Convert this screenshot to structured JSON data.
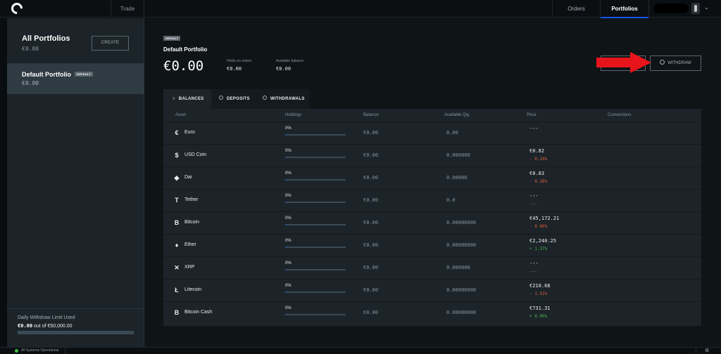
{
  "topbar": {
    "nav_trade": "Trade",
    "nav_orders": "Orders",
    "nav_portfolios": "Portfolios",
    "chevron": "⌄"
  },
  "sidebar": {
    "all_portfolios_title": "All Portfolios",
    "all_portfolios_value": "€0.00",
    "create_label": "CREATE",
    "selected_portfolio": {
      "name": "Default Portfolio",
      "badge": "DEFAULT",
      "value": "€0.00"
    },
    "withdraw_limit_label": "Daily Withdraw Limit Used",
    "withdraw_limit_used": "€0.00",
    "withdraw_limit_rest": " out of €50,000.00",
    "withdraw_limit_fraction": 0
  },
  "main": {
    "badge": "DEFAULT",
    "title": "Default Portfolio",
    "total_value": "€0.00",
    "holds_label": "Holds on orders",
    "holds_value": "€0.00",
    "available_label": "Available balance",
    "available_value": "€0.00",
    "withdraw_label": "WITHDRAW",
    "annotation_arrow_color": "#e8141b"
  },
  "tabs": [
    {
      "label": "BALANCES",
      "icon": "balances-icon",
      "active": true
    },
    {
      "label": "DEPOSITS",
      "icon": "deposit-icon",
      "active": false
    },
    {
      "label": "WITHDRAWALS",
      "icon": "withdraw-icon",
      "active": false
    }
  ],
  "table": {
    "headers": [
      "Asset",
      "Holdings",
      "Balance",
      "Available Qty.",
      "Price",
      "Conversions"
    ],
    "rows": [
      {
        "icon": "euro-icon",
        "glyph": "€",
        "asset": "Euro",
        "holdings": "0%",
        "holdings_fraction": 0,
        "balance": "€0.00",
        "qty": "0.00",
        "price": "---",
        "change": "",
        "trend": "dash"
      },
      {
        "icon": "usdc-icon",
        "glyph": "$",
        "asset": "USD Coin",
        "holdings": "0%",
        "holdings_fraction": 0,
        "balance": "€0.00",
        "qty": "0.000000",
        "price": "€0.82",
        "change": "- 0.24%",
        "trend": "neg"
      },
      {
        "icon": "dai-icon",
        "glyph": "◆",
        "asset": "Dai",
        "holdings": "0%",
        "holdings_fraction": 0,
        "balance": "€0.00",
        "qty": "0.00000",
        "price": "€0.83",
        "change": "- 0.28%",
        "trend": "neg"
      },
      {
        "icon": "tether-icon",
        "glyph": "T",
        "asset": "Tether",
        "holdings": "0%",
        "holdings_fraction": 0,
        "balance": "€0.00",
        "qty": "0.0",
        "price": "---",
        "change": "---",
        "trend": "dash"
      },
      {
        "icon": "bitcoin-icon",
        "glyph": "B",
        "asset": "Bitcoin",
        "holdings": "0%",
        "holdings_fraction": 0,
        "balance": "€0.00",
        "qty": "0.00000000",
        "price": "€45,172.21",
        "change": "- 0.80%",
        "trend": "neg"
      },
      {
        "icon": "ether-icon",
        "glyph": "♦",
        "asset": "Ether",
        "holdings": "0%",
        "holdings_fraction": 0,
        "balance": "€0.00",
        "qty": "0.00000000",
        "price": "€2,240.25",
        "change": "+ 1.37%",
        "trend": "pos"
      },
      {
        "icon": "xrp-icon",
        "glyph": "✕",
        "asset": "XRP",
        "holdings": "0%",
        "holdings_fraction": 0,
        "balance": "€0.00",
        "qty": "0.000000",
        "price": "---",
        "change": "---",
        "trend": "dash"
      },
      {
        "icon": "litecoin-icon",
        "glyph": "Ł",
        "asset": "Litecoin",
        "holdings": "0%",
        "holdings_fraction": 0,
        "balance": "€0.00",
        "qty": "0.00000000",
        "price": "€210.68",
        "change": "- 1.51%",
        "trend": "neg"
      },
      {
        "icon": "bitcoin-cash-icon",
        "glyph": "B",
        "asset": "Bitcoin Cash",
        "holdings": "0%",
        "holdings_fraction": 0,
        "balance": "€0.00",
        "qty": "0.00000000",
        "price": "€731.31",
        "change": "+ 0.00%",
        "trend": "pos"
      }
    ]
  },
  "statusbar": {
    "status_text": "All Systems Operational",
    "status_color": "#3fbf3f"
  }
}
